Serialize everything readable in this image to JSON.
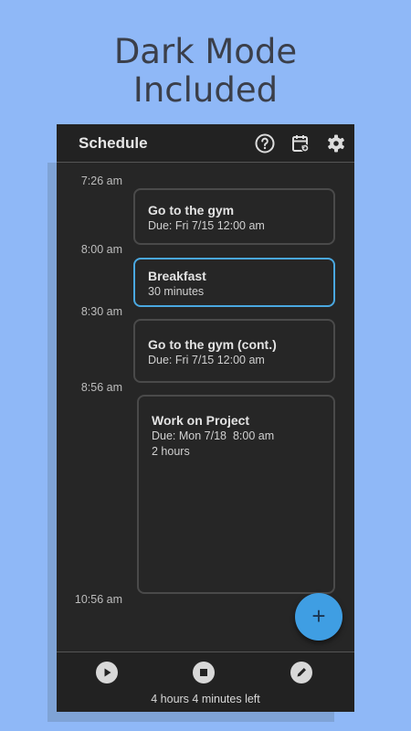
{
  "promo": {
    "line1": "Dark Mode",
    "line2": "Included"
  },
  "app": {
    "title": "Schedule"
  },
  "icons": {
    "help": "help-circle-icon",
    "calendar": "calendar-sync-icon",
    "settings": "gear-icon",
    "add": "plus-icon",
    "play": "play-icon",
    "stop": "stop-icon",
    "edit": "pencil-icon"
  },
  "timeline": {
    "times": [
      "7:26 am",
      "8:00 am",
      "8:30 am",
      "8:56 am",
      "10:56 am"
    ],
    "events": [
      {
        "title": "Go to the gym",
        "lines": [
          "Due: Fri 7/15 12:00 am"
        ]
      },
      {
        "title": "Breakfast",
        "lines": [
          "30 minutes"
        ]
      },
      {
        "title": "Go to the gym (cont.)",
        "lines": [
          "Due: Fri 7/15 12:00 am"
        ]
      },
      {
        "title": "Work on Project",
        "lines": [
          "Due: Mon 7/18  8:00 am",
          "2 hours"
        ]
      }
    ]
  },
  "fab": {
    "label": "+"
  },
  "footer": {
    "remaining": "4 hours 4 minutes left"
  },
  "colors": {
    "background": "#8fb8f7",
    "surface": "#262626",
    "accent": "#3f9ee3",
    "selected_border": "#4aa8e0"
  }
}
